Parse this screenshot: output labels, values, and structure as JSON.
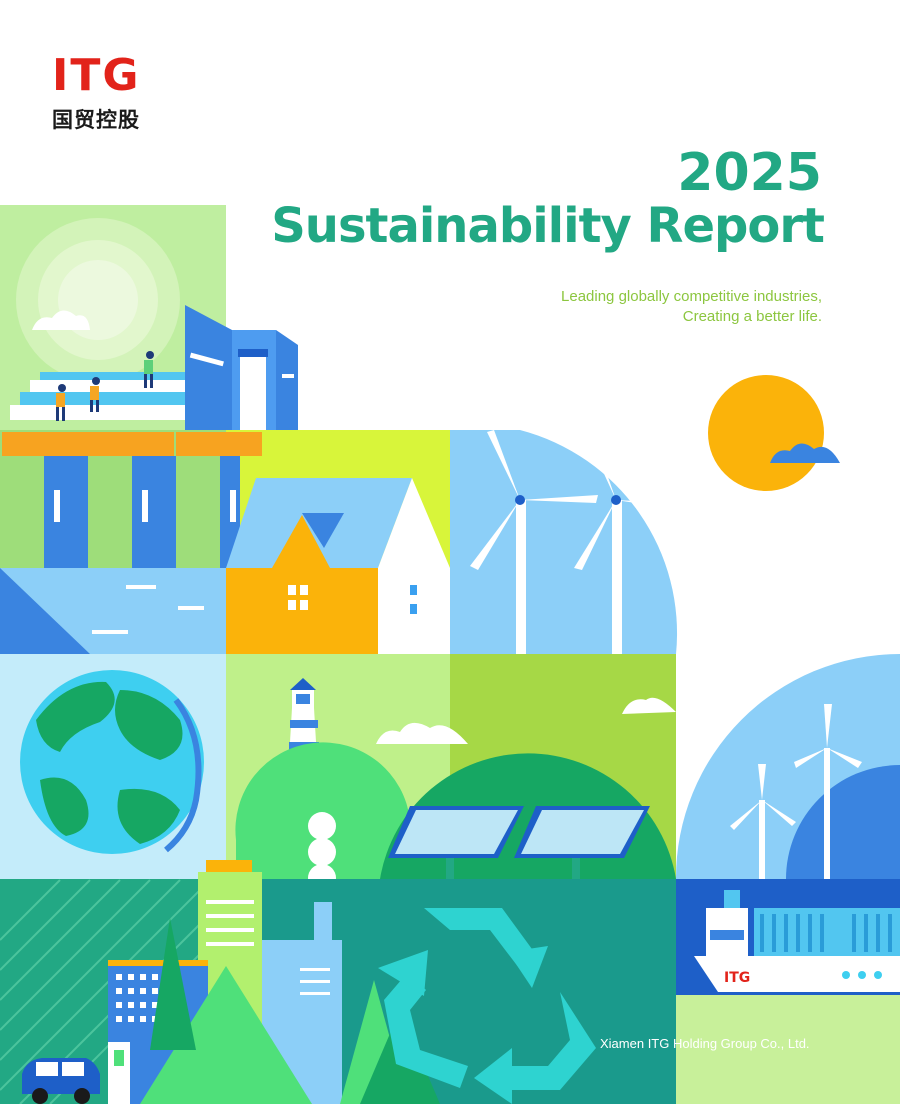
{
  "brand": {
    "logo_text": "ITG",
    "logo_subtitle": "国贸控股",
    "brand_color": "#e2231a"
  },
  "report": {
    "year": "2025",
    "title": "Sustainability Report",
    "tagline_line1": "Leading globally competitive industries,",
    "tagline_line2": "Creating a better life.",
    "accent_color": "#22a884"
  },
  "ship": {
    "label": "ITG"
  },
  "footer": {
    "company": "Xiamen ITG Holding Group Co., Ltd."
  }
}
